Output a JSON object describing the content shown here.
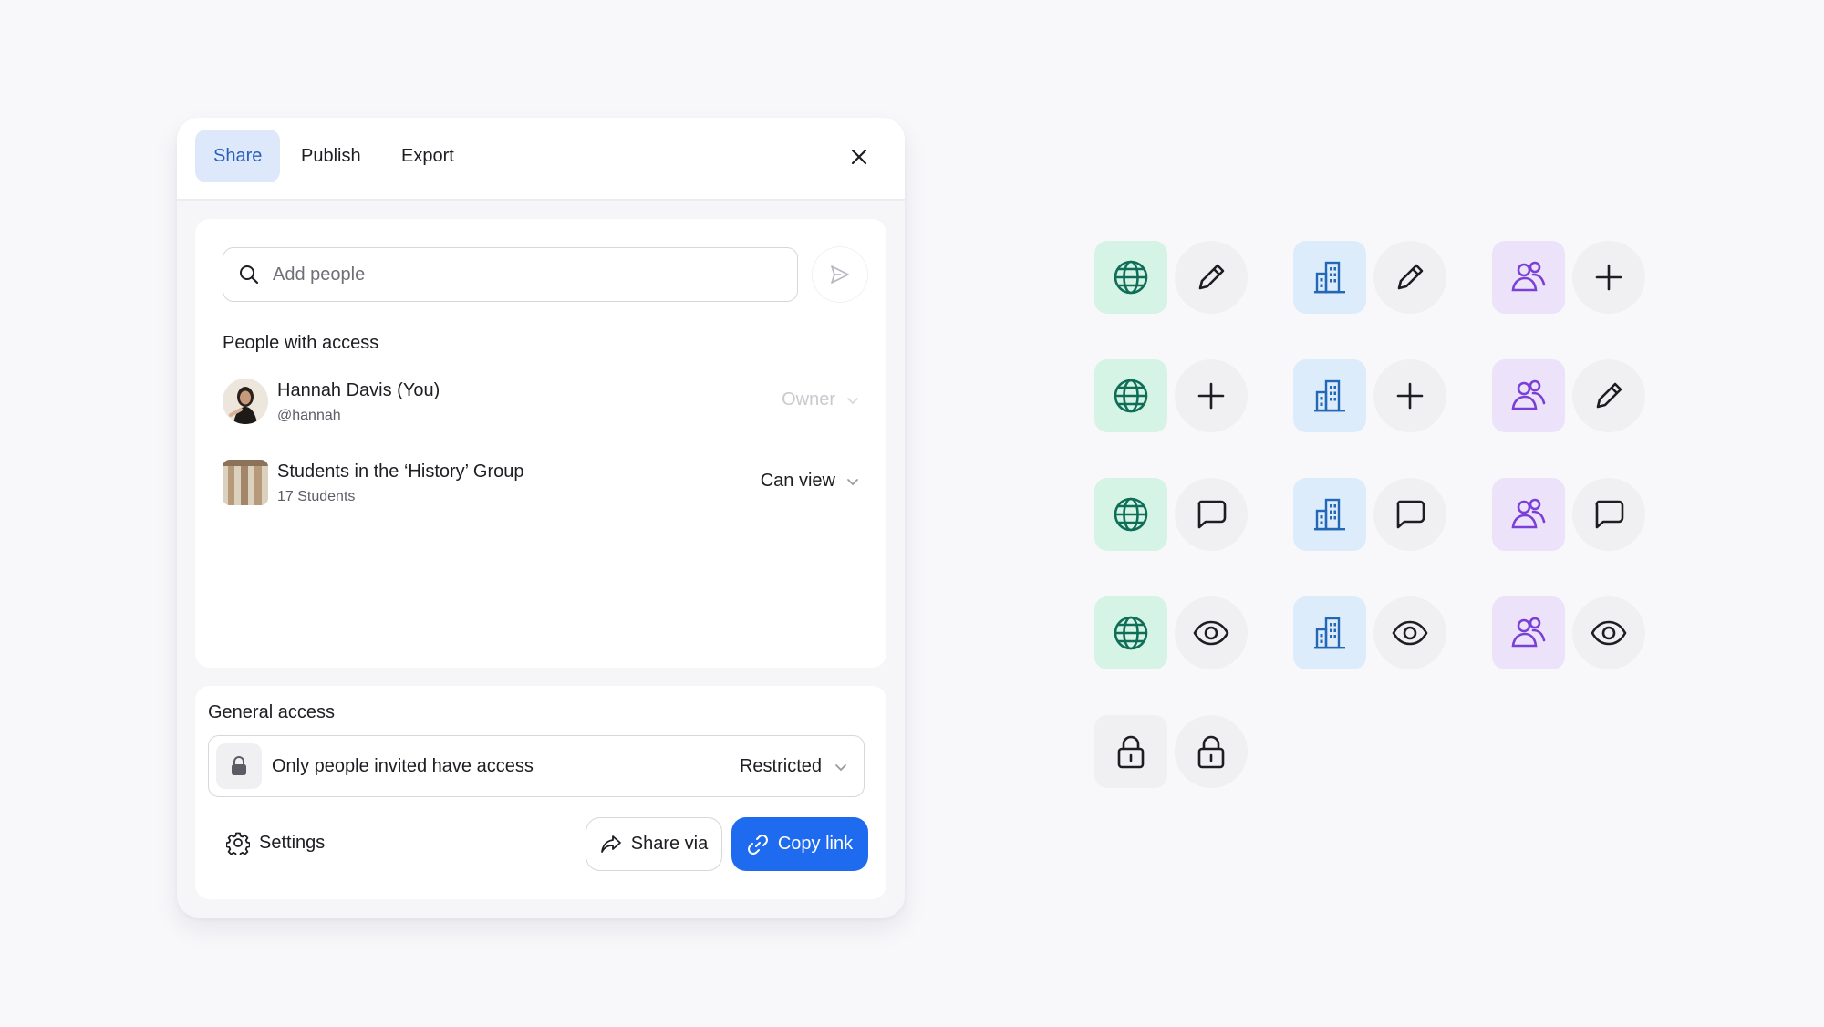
{
  "tabs": [
    {
      "label": "Share",
      "active": true
    },
    {
      "label": "Publish",
      "active": false
    },
    {
      "label": "Export",
      "active": false
    }
  ],
  "search": {
    "placeholder": "Add people",
    "value": ""
  },
  "people_section": {
    "title": "People with access",
    "people": [
      {
        "name": "Hannah Davis (You)",
        "sub": "@hannah",
        "role": "Owner",
        "role_enabled": false,
        "avatar": "user-photo"
      },
      {
        "name": "Students in the ‘History’ Group",
        "sub": "17 Students",
        "role": "Can view",
        "role_enabled": true,
        "avatar": "group-photo"
      }
    ]
  },
  "general_access": {
    "title": "General access",
    "description": "Only people invited have access",
    "level": "Restricted"
  },
  "footer": {
    "settings_label": "Settings",
    "share_via_label": "Share via",
    "copy_link_label": "Copy link"
  },
  "colors": {
    "accent": "#1f6bf0",
    "tab_active_bg": "#dde9fb",
    "green_tile": "#d6f4e6",
    "green_icon": "#0f6e58",
    "blue_tile": "#dcecfb",
    "blue_icon": "#2368b6",
    "purple_tile": "#ece3fb",
    "purple_icon": "#7a3fd6"
  },
  "icon_grid": [
    [
      "globe-icon",
      "pencil-icon",
      "building-icon",
      "pencil-icon",
      "people-icon",
      "plus-icon"
    ],
    [
      "globe-icon",
      "plus-icon",
      "building-icon",
      "plus-icon",
      "people-icon",
      "pencil-icon"
    ],
    [
      "globe-icon",
      "comment-icon",
      "building-icon",
      "comment-icon",
      "people-icon",
      "comment-icon"
    ],
    [
      "globe-icon",
      "eye-icon",
      "building-icon",
      "eye-icon",
      "people-icon",
      "eye-icon"
    ],
    [
      "lock-icon",
      "lock-icon"
    ]
  ]
}
